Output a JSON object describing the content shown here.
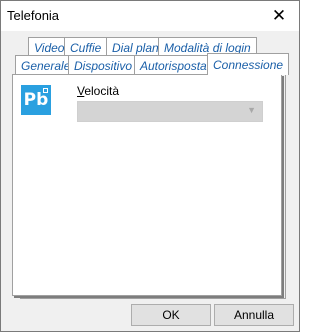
{
  "window": {
    "title": "Telefonia",
    "close_symbol": "✕"
  },
  "tabs_row_back": [
    {
      "label": "Video"
    },
    {
      "label": "Cuffie"
    },
    {
      "label": "Dial plan"
    },
    {
      "label": "Modalità di login"
    }
  ],
  "tabs_row_front": [
    {
      "label": "Generale"
    },
    {
      "label": "Dispositivo"
    },
    {
      "label": "Autorisposta"
    },
    {
      "label": "Connessione",
      "active": true
    }
  ],
  "panel": {
    "logo_text": "Pb",
    "field_label_accel": "V",
    "field_label_rest": "elocità",
    "combo_value": ""
  },
  "buttons": {
    "ok": "OK",
    "cancel": "Annulla"
  },
  "colors": {
    "tab_text": "#1a5fa8",
    "logo_bg": "#2aa0e0"
  }
}
